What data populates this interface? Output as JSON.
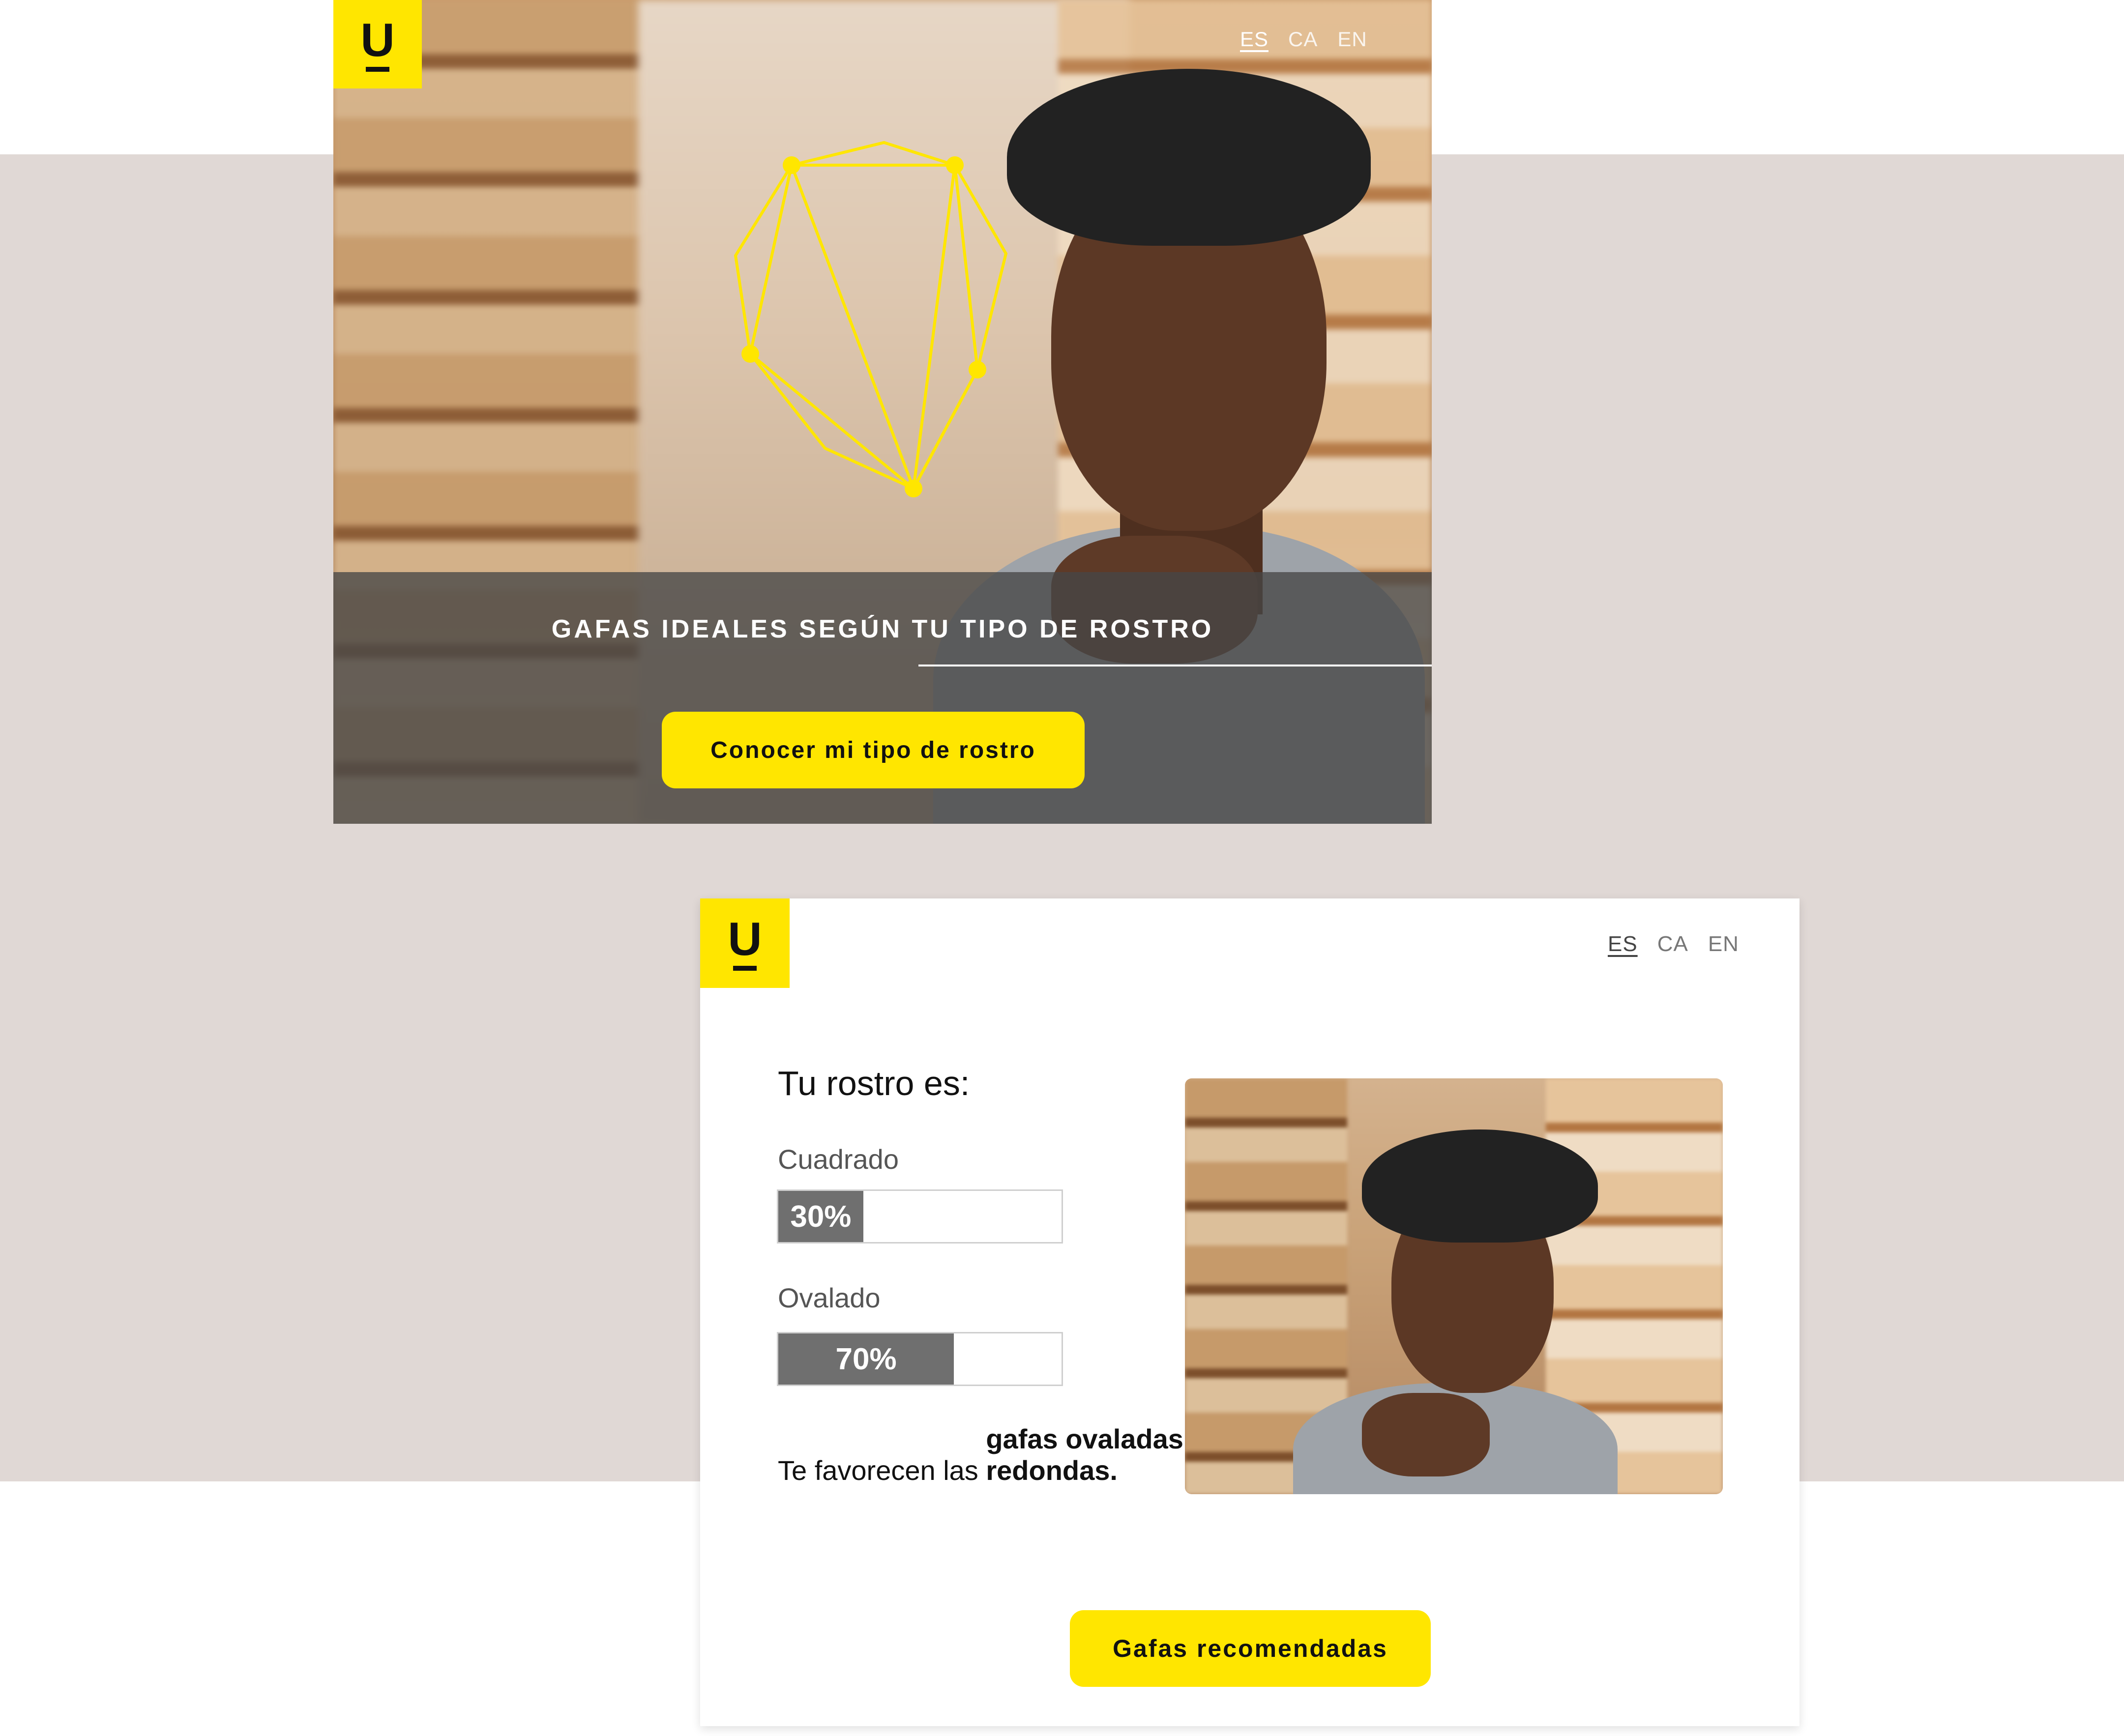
{
  "brand": {
    "logo_letter": "U",
    "accent_color": "#ffe600"
  },
  "hero": {
    "languages": [
      {
        "code": "ES",
        "active": true
      },
      {
        "code": "CA",
        "active": false
      },
      {
        "code": "EN",
        "active": false
      }
    ],
    "title": "GAFAS IDEALES SEGÚN TU TIPO DE ROSTRO",
    "cta_label": "Conocer mi tipo de rostro"
  },
  "result": {
    "languages": [
      {
        "code": "ES",
        "active": true
      },
      {
        "code": "CA",
        "active": false
      },
      {
        "code": "EN",
        "active": false
      }
    ],
    "title": "Tu rostro es:",
    "shapes": [
      {
        "name": "Cuadrado",
        "percent_label": "30%",
        "value": 0.3
      },
      {
        "name": "Ovalado",
        "percent_label": "70%",
        "value": 0.7
      }
    ],
    "recommendation_prefix": "Te favorecen las ",
    "recommendation_bold": "gafas ovaladas o redondas.",
    "cta_label": "Gafas recomendadas"
  }
}
